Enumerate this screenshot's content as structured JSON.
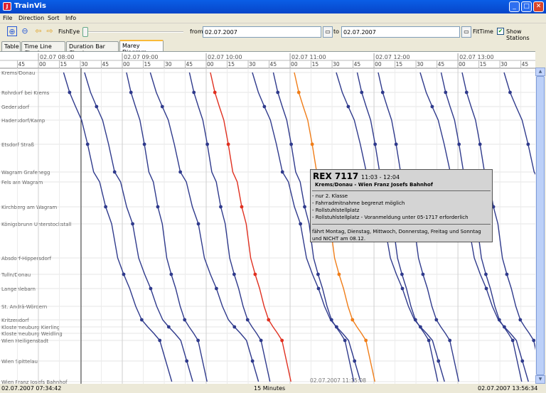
{
  "window": {
    "title": "TrainVis",
    "minimize": "_",
    "maximize": "□",
    "close": "✕"
  },
  "menu": [
    "File",
    "Direction",
    "Sort",
    "Info"
  ],
  "toolbar": {
    "fisheye_label": "FishEye",
    "from_label": "from",
    "from_value": "02.07.2007",
    "to_label": "to",
    "to_value": "02.07.2007",
    "fittime_label": "FitTime",
    "show_stations_label": "Show Stations",
    "show_stations_checked": true,
    "icons": [
      "zoom-fit-icon",
      "zoom-icon",
      "arrow-left-icon",
      "arrow-right-icon",
      "calendar-icon"
    ]
  },
  "tabs": [
    "Table",
    "Time Line Chart",
    "Duration Bar Chart",
    "Marey Diagram"
  ],
  "active_tab": "Marey Diagram",
  "time_header": {
    "hours": [
      "02.07 08:00",
      "02.07 09:00",
      "02.07 10:00",
      "02.07 11:00",
      "02.07 12:00",
      "02.07 13:00"
    ],
    "minute_ticks": [
      "30",
      "45",
      "00",
      "15",
      "30",
      "45",
      "00",
      "15",
      "30",
      "45",
      "00",
      "15",
      "30",
      "45",
      "00",
      "15",
      "30",
      "45",
      "00",
      "15",
      "30",
      "45",
      "00",
      "15",
      "30",
      "45",
      "0"
    ]
  },
  "stations": [
    "Krems/Donau",
    "Rohrdorf bei Krems",
    "Gedersdorf",
    "Hadersdorf/Kamp",
    "Etsdorf Straß",
    "Wagram Grafenegg",
    "Fels am Wagram",
    "Kirchberg am Wagram",
    "Königsbrunn Unterstockstall",
    "Absdorf-Hippersdorf",
    "Tulln/Donau",
    "Langenlebarn",
    "St. Andrä-Wördern",
    "Kritzendorf",
    "Klosterneuburg Kierling",
    "Klosterneuburg Weidling",
    "Wien Heiligenstadt",
    "Wien Spittelau",
    "Wien Franz Josefs Bahnhof"
  ],
  "colors": {
    "regular_train": "#2f3a8c",
    "highlight_train": "#e03020",
    "hover_train": "#f07d18",
    "grid": "#e5e5e5"
  },
  "tooltip": {
    "train": "REX 7117",
    "time": "11:03 - 12:04",
    "route": "Krems/Donau - Wien Franz Josefs Bahnhof",
    "notes": [
      "- nur 2. Klasse",
      "- Fahrradmitnahme begrenzt möglich",
      "- Rollstuhlstellplatz",
      "- Rollstuhlstellplatz - Voranmeldung unter 05-1717 erforderlich"
    ],
    "days": " fährt Montag, Dienstag, Mittwoch, Donnerstag, Freitag und Sonntag und NICHT am 08.12."
  },
  "cursor_label": "02.07.2007 11:15:08",
  "status": {
    "start": "02.07.2007 07:34:42",
    "interval": "15 Minutes",
    "end": "02.07.2007 13:56:34"
  }
}
